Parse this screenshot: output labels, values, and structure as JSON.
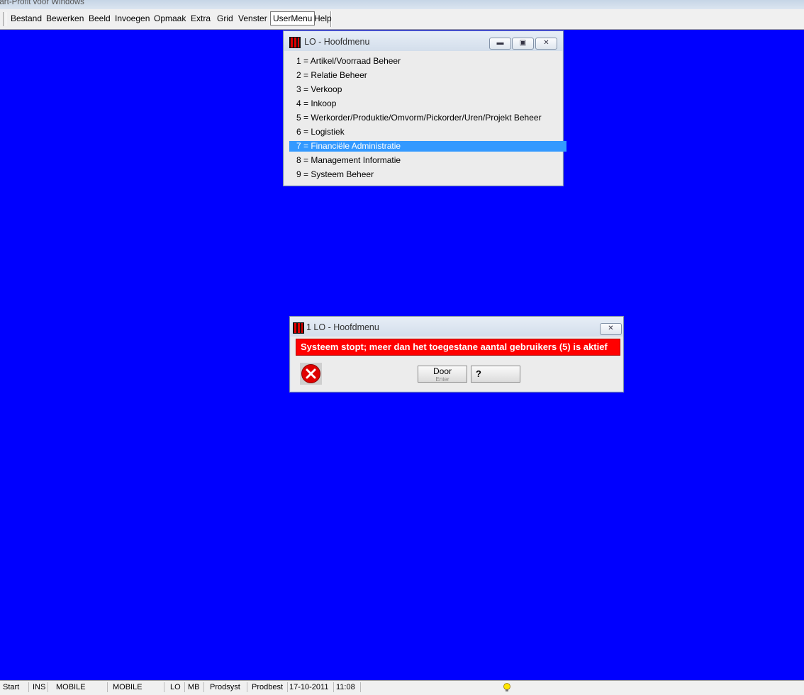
{
  "app_title": "eart-Profit voor Windows",
  "menubar": {
    "items": [
      "Bestand",
      "Bewerken",
      "Beeld",
      "Invoegen",
      "Opmaak",
      "Extra",
      "Grid",
      "Venster",
      "UserMenu",
      "Help"
    ]
  },
  "main_window": {
    "title": "LO - Hoofdmenu",
    "items": [
      "1 = Artikel/Voorraad Beheer",
      "2 = Relatie Beheer",
      "3 = Verkoop",
      "4 = Inkoop",
      "5 = Werkorder/Produktie/Omvorm/Pickorder/Uren/Projekt Beheer",
      "6 = Logistiek",
      "7 = Financiële Administratie",
      "8 = Management Informatie",
      "9 = Systeem Beheer"
    ],
    "selected_index": 6
  },
  "dialog": {
    "title": "1 LO - Hoofdmenu",
    "message": "Systeem stopt; meer dan het toegestane aantal gebruikers (5) is aktief",
    "door_button": "Door",
    "door_hint": "Enter",
    "help_button": "?"
  },
  "statusbar": [
    "Start",
    "INS",
    "MOBILE",
    "MOBILE",
    "LO",
    "MB",
    "Prodsyst",
    "Prodbest",
    "17-10-2011",
    "11:08"
  ],
  "colors": {
    "desktop": "#0000ff",
    "selection": "#3399ff",
    "alert": "#ff0000"
  },
  "icons": [
    "app-logo-icon",
    "minimize-icon",
    "restore-icon",
    "close-icon",
    "error-icon",
    "question-icon",
    "lightbulb-icon"
  ]
}
